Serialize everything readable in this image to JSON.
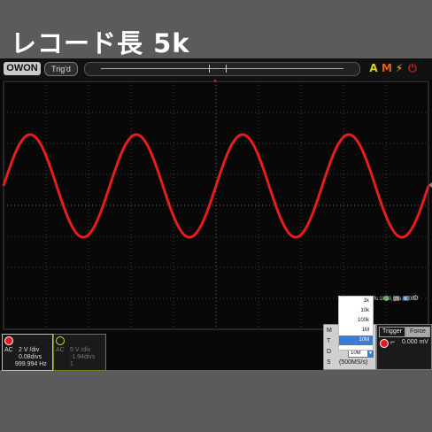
{
  "heading": "レコード長 5k",
  "toolbar": {
    "logo": "OWON",
    "trigger_status": "Trig'd",
    "icons": [
      "auto-icon",
      "meter-icon",
      "flash-icon",
      "power-icon"
    ]
  },
  "colors": {
    "ch1": "#e81c1c",
    "ch2": "#d7d240",
    "grid": "#3a3a3a",
    "trigger_marker": "#e81c1c"
  },
  "waveform": {
    "cycles": 4,
    "shape": "sine"
  },
  "acquisition": {
    "info": "wfs:1810, pts:4000"
  },
  "record_length_dropdown": {
    "options": [
      "1k",
      "10k",
      "100k",
      "1M",
      "10M"
    ],
    "selected": "10M"
  },
  "menu": {
    "rows": [
      "M",
      "T",
      "D",
      "S"
    ],
    "depth_value": "10M",
    "sample_rate": "(500MS/s)"
  },
  "ch1": {
    "coupling": "AC",
    "volts_div": "2 V /div",
    "offset": "0.08divs",
    "frequency": "999.994 Hz"
  },
  "ch2": {
    "coupling": "AC",
    "volts_div": "5 V /div",
    "offset": "-1.94divs",
    "extra": "1"
  },
  "trigger": {
    "btn_trigger": "Trigger",
    "btn_force": "Force",
    "level": "0.000 mV"
  }
}
